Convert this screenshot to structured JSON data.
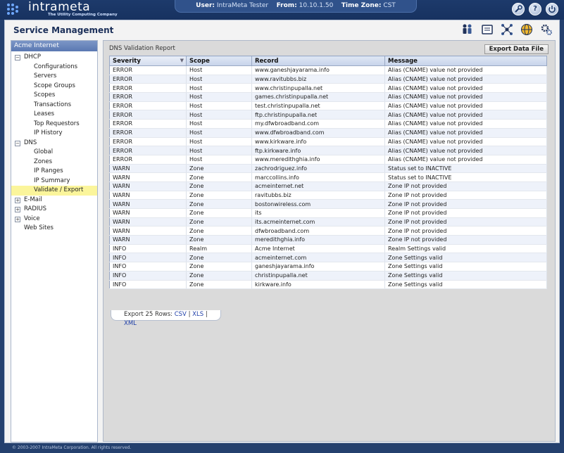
{
  "brand": {
    "name": "intrameta",
    "tagline": "The Utility Computing Company"
  },
  "userbar": {
    "user_label": "User:",
    "user_value": "IntraMeta Tester",
    "from_label": "From:",
    "from_value": "10.10.1.50",
    "tz_label": "Time Zone:",
    "tz_value": "CST"
  },
  "top_icons": [
    "wrench-icon",
    "help-icon",
    "power-icon"
  ],
  "page_title": "Service Management",
  "toolbar_icons": [
    "users-icon",
    "device-icon",
    "network-icon",
    "globe-icon",
    "gears-icon"
  ],
  "sidebar": {
    "header": "Acme Internet",
    "tree": [
      {
        "label": "DHCP",
        "level": 1,
        "toggle": "−"
      },
      {
        "label": "Configurations",
        "level": 2
      },
      {
        "label": "Servers",
        "level": 2
      },
      {
        "label": "Scope Groups",
        "level": 2
      },
      {
        "label": "Scopes",
        "level": 2
      },
      {
        "label": "Transactions",
        "level": 2
      },
      {
        "label": "Leases",
        "level": 2
      },
      {
        "label": "Top Requestors",
        "level": 2
      },
      {
        "label": "IP History",
        "level": 2
      },
      {
        "label": "DNS",
        "level": 1,
        "toggle": "−"
      },
      {
        "label": "Global",
        "level": 2
      },
      {
        "label": "Zones",
        "level": 2
      },
      {
        "label": "IP Ranges",
        "level": 2
      },
      {
        "label": "IP Summary",
        "level": 2
      },
      {
        "label": "Validate / Export",
        "level": 2,
        "selected": true
      },
      {
        "label": "E-Mail",
        "level": 1,
        "toggle": "+"
      },
      {
        "label": "RADIUS",
        "level": 1,
        "toggle": "+"
      },
      {
        "label": "Voice",
        "level": 1,
        "toggle": "+"
      },
      {
        "label": "Web Sites",
        "level": 1
      }
    ]
  },
  "report": {
    "title": "DNS Validation Report",
    "export_button": "Export Data File",
    "columns": [
      "Severity",
      "Scope",
      "Record",
      "Message"
    ],
    "rows": [
      [
        "ERROR",
        "Host",
        "www.ganeshjayarama.info",
        "Alias (CNAME) value not provided"
      ],
      [
        "ERROR",
        "Host",
        "www.ravitubbs.biz",
        "Alias (CNAME) value not provided"
      ],
      [
        "ERROR",
        "Host",
        "www.christinpupalla.net",
        "Alias (CNAME) value not provided"
      ],
      [
        "ERROR",
        "Host",
        "games.christinpupalla.net",
        "Alias (CNAME) value not provided"
      ],
      [
        "ERROR",
        "Host",
        "test.christinpupalla.net",
        "Alias (CNAME) value not provided"
      ],
      [
        "ERROR",
        "Host",
        "ftp.christinpupalla.net",
        "Alias (CNAME) value not provided"
      ],
      [
        "ERROR",
        "Host",
        "my.dfwbroadband.com",
        "Alias (CNAME) value not provided"
      ],
      [
        "ERROR",
        "Host",
        "www.dfwbroadband.com",
        "Alias (CNAME) value not provided"
      ],
      [
        "ERROR",
        "Host",
        "www.kirkware.info",
        "Alias (CNAME) value not provided"
      ],
      [
        "ERROR",
        "Host",
        "ftp.kirkware.info",
        "Alias (CNAME) value not provided"
      ],
      [
        "ERROR",
        "Host",
        "www.meredithghia.info",
        "Alias (CNAME) value not provided"
      ],
      [
        "WARN",
        "Zone",
        "zachrodriguez.info",
        "Status set to INACTIVE"
      ],
      [
        "WARN",
        "Zone",
        "marccollins.info",
        "Status set to INACTIVE"
      ],
      [
        "WARN",
        "Zone",
        "acmeinternet.net",
        "Zone IP not provided"
      ],
      [
        "WARN",
        "Zone",
        "ravitubbs.biz",
        "Zone IP not provided"
      ],
      [
        "WARN",
        "Zone",
        "bostonwireless.com",
        "Zone IP not provided"
      ],
      [
        "WARN",
        "Zone",
        "its",
        "Zone IP not provided"
      ],
      [
        "WARN",
        "Zone",
        "its.acmeinternet.com",
        "Zone IP not provided"
      ],
      [
        "WARN",
        "Zone",
        "dfwbroadband.com",
        "Zone IP not provided"
      ],
      [
        "WARN",
        "Zone",
        "meredithghia.info",
        "Zone IP not provided"
      ],
      [
        "INFO",
        "Realm",
        "Acme Internet",
        "Realm Settings valid"
      ],
      [
        "INFO",
        "Zone",
        "acmeinternet.com",
        "Zone Settings valid"
      ],
      [
        "INFO",
        "Zone",
        "ganeshjayarama.info",
        "Zone Settings valid"
      ],
      [
        "INFO",
        "Zone",
        "christinpupalla.net",
        "Zone Settings valid"
      ],
      [
        "INFO",
        "Zone",
        "kirkware.info",
        "Zone Settings valid"
      ]
    ],
    "export_rows_text": "Export 25 Rows:",
    "export_formats": [
      "CSV",
      "XLS",
      "XML"
    ]
  },
  "footer": "© 2003-2007 IntraMeta Corporation.  All rights reserved.",
  "colors": {
    "accent": "#24406e",
    "selected": "#fbf59b",
    "header_bg": "#c6d3ea"
  }
}
